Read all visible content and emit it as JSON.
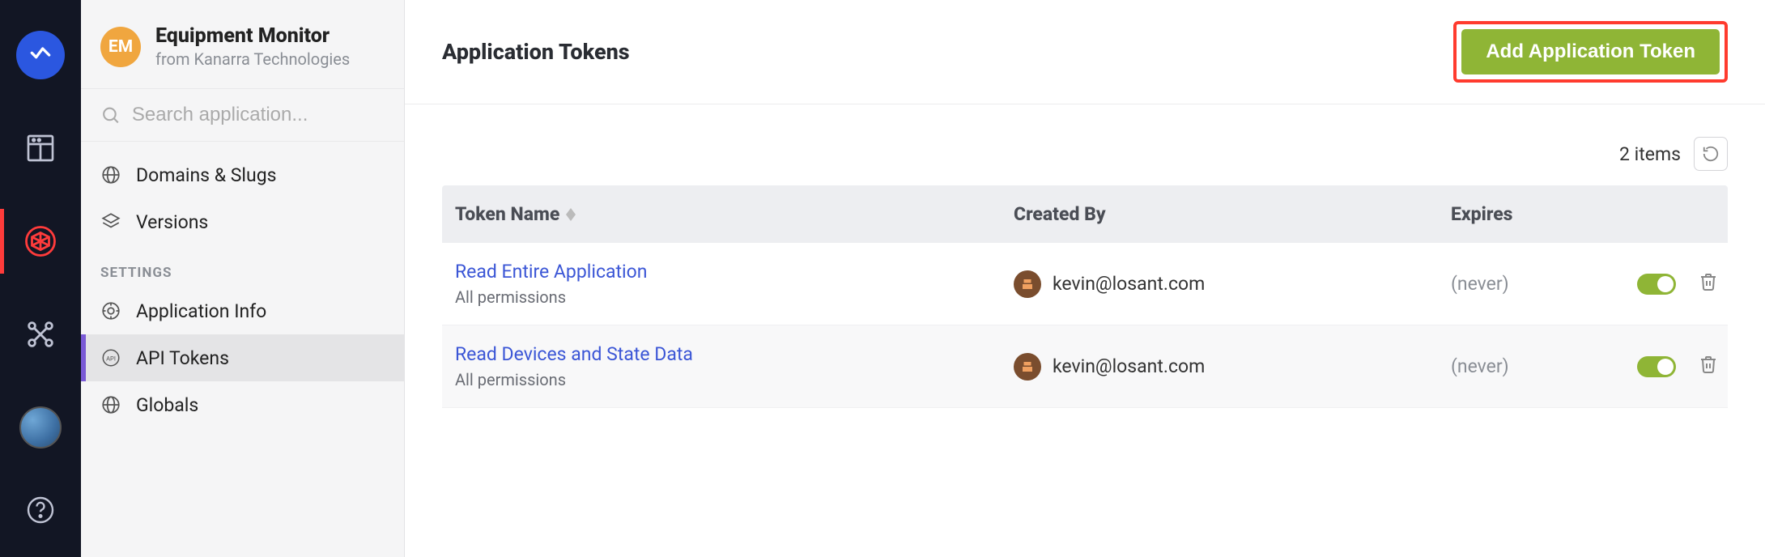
{
  "rail": {
    "items": [
      "logo",
      "dashboard",
      "devices",
      "workflows",
      "avatar",
      "help"
    ]
  },
  "app": {
    "badge": "EM",
    "title": "Equipment Monitor",
    "from_prefix": "from ",
    "org": "Kanarra Technologies"
  },
  "search": {
    "placeholder": "Search application..."
  },
  "sidebar": {
    "items": [
      {
        "label": "Domains & Slugs"
      },
      {
        "label": "Versions"
      }
    ],
    "settings_label": "SETTINGS",
    "settings_items": [
      {
        "label": "Application Info"
      },
      {
        "label": "API Tokens"
      },
      {
        "label": "Globals"
      }
    ]
  },
  "page": {
    "title": "Application Tokens",
    "add_button": "Add Application Token",
    "items_count": "2 items"
  },
  "table": {
    "columns": {
      "name": "Token Name",
      "created_by": "Created By",
      "expires": "Expires"
    },
    "rows": [
      {
        "name": "Read Entire Application",
        "subtitle": "All permissions",
        "created_by": "kevin@losant.com",
        "expires": "(never)",
        "enabled": true
      },
      {
        "name": "Read Devices and State Data",
        "subtitle": "All permissions",
        "created_by": "kevin@losant.com",
        "expires": "(never)",
        "enabled": true
      }
    ]
  }
}
